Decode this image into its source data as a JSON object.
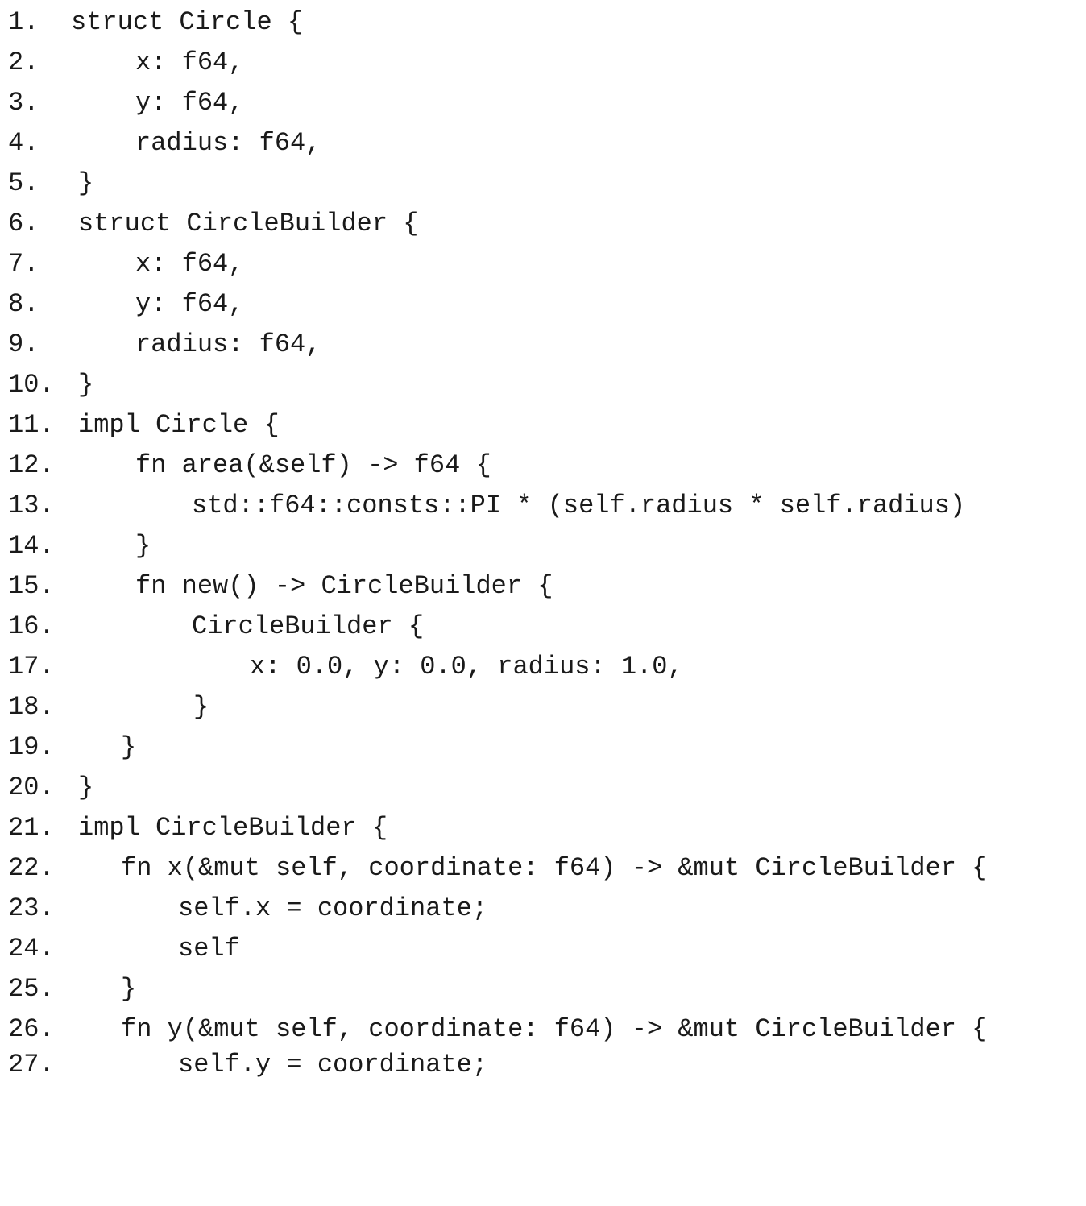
{
  "code": {
    "lines": [
      {
        "number": "1.",
        "text": "struct Circle {"
      },
      {
        "number": "2.",
        "text": "x: f64,"
      },
      {
        "number": "3.",
        "text": "y: f64,"
      },
      {
        "number": "4.",
        "text": "radius: f64,"
      },
      {
        "number": "5.",
        "text": "}"
      },
      {
        "number": "6.",
        "text": "struct CircleBuilder {"
      },
      {
        "number": "7.",
        "text": "x: f64,"
      },
      {
        "number": "8.",
        "text": "y: f64,"
      },
      {
        "number": "9.",
        "text": "radius: f64,"
      },
      {
        "number": "10.",
        "text": "}"
      },
      {
        "number": "11.",
        "text": "impl Circle {"
      },
      {
        "number": "12.",
        "text": "fn area(&self) -> f64 {"
      },
      {
        "number": "13.",
        "text": "std::f64::consts::PI * (self.radius * self.radius)"
      },
      {
        "number": "14.",
        "text": "}"
      },
      {
        "number": "15.",
        "text": "fn new() -> CircleBuilder {"
      },
      {
        "number": "16.",
        "text": "CircleBuilder {"
      },
      {
        "number": "17.",
        "text": "x: 0.0, y: 0.0, radius: 1.0,"
      },
      {
        "number": "18.",
        "text": "}"
      },
      {
        "number": "19.",
        "text": "}"
      },
      {
        "number": "20.",
        "text": "}"
      },
      {
        "number": "21.",
        "text": "impl CircleBuilder {"
      },
      {
        "number": "22.",
        "text": "fn x(&mut self, coordinate: f64) -> &mut CircleBuilder {"
      },
      {
        "number": "23.",
        "text": "self.x = coordinate;"
      },
      {
        "number": "24.",
        "text": "self"
      },
      {
        "number": "25.",
        "text": "}"
      },
      {
        "number": "26.",
        "text": "fn y(&mut self, coordinate: f64) -> &mut CircleBuilder {"
      },
      {
        "number": "27.",
        "text": "self.y = coordinate;"
      }
    ]
  }
}
